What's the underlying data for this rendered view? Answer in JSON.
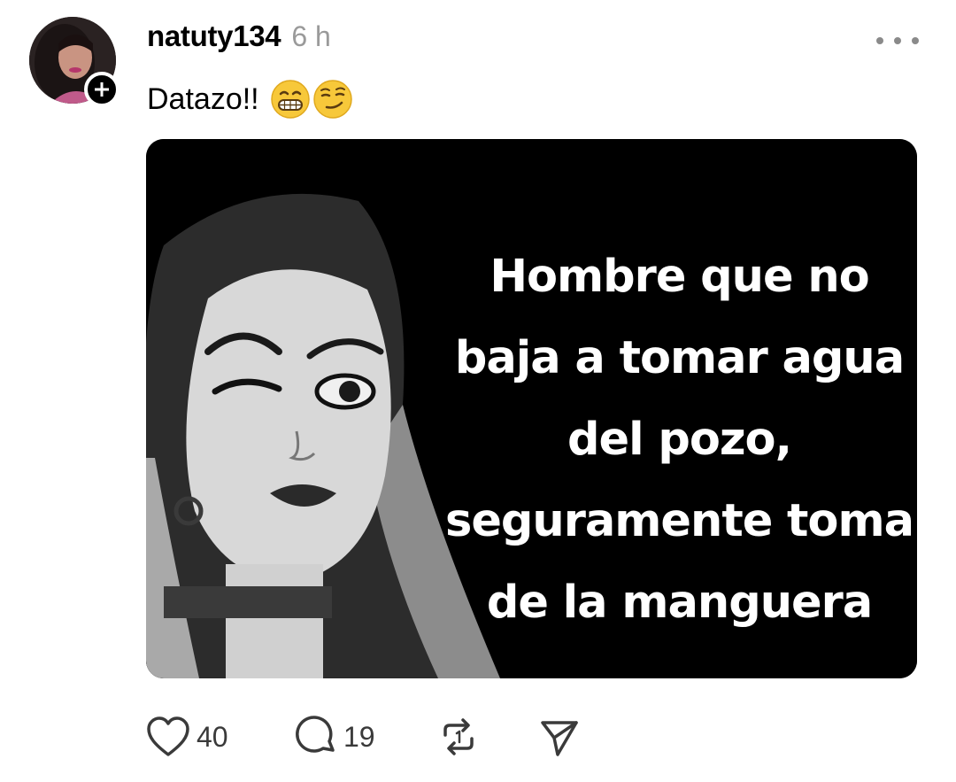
{
  "post": {
    "username": "natuty134",
    "timestamp": "6 h",
    "text": "Datazo!!",
    "emojis": [
      "grinning-face-with-teeth",
      "smirking-face"
    ]
  },
  "media": {
    "caption_lines": [
      "Hombre que no",
      "baja a tomar agua",
      "del pozo,",
      "seguramente toma",
      "de la manguera"
    ]
  },
  "actions": {
    "likes": "40",
    "replies": "19",
    "icons": [
      "heart-icon",
      "comment-icon",
      "repost-icon",
      "share-icon"
    ]
  },
  "colors": {
    "text": "#000000",
    "muted": "#9a9a9a",
    "icon": "#3a3a3a",
    "media_bg": "#000000"
  }
}
